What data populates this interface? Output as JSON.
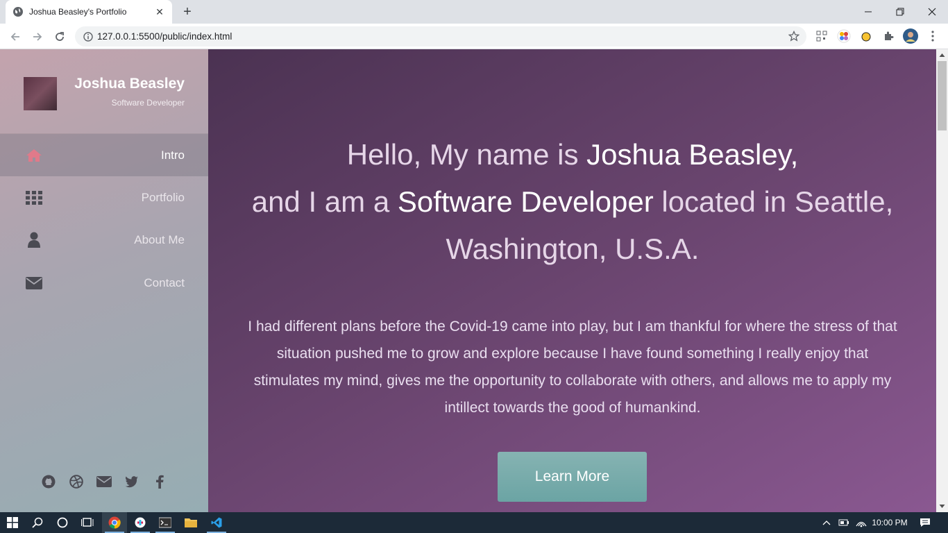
{
  "browser": {
    "tab_title": "Joshua Beasley's Portfolio",
    "url": "127.0.0.1:5500/public/index.html"
  },
  "sidebar": {
    "name": "Joshua Beasley",
    "role": "Software Developer",
    "items": [
      {
        "label": "Intro",
        "icon": "home-icon"
      },
      {
        "label": "Portfolio",
        "icon": "grid-icon"
      },
      {
        "label": "About Me",
        "icon": "user-icon"
      },
      {
        "label": "Contact",
        "icon": "envelope-icon"
      }
    ],
    "socials": [
      "github-icon",
      "dribbble-icon",
      "email-icon",
      "twitter-icon",
      "facebook-icon"
    ]
  },
  "hero": {
    "line1_pre": "Hello, My name is ",
    "line1_name": "Joshua Beasley,",
    "line2_pre": "and I am a ",
    "line2_role": "Software Developer",
    "line2_post": " located in Seattle, Washington, U.S.A.",
    "blurb": "I had different plans before the Covid-19 came into play, but I am thankful for where the stress of that situation pushed me to grow and explore because I have found something I really enjoy that stimulates my mind, gives me the opportunity to collaborate with others, and allows me to apply my intillect towards the good of humankind.",
    "button": "Learn More"
  },
  "taskbar": {
    "time": "10:00 PM"
  },
  "colors": {
    "main_gradient_start": "#4b3252",
    "main_gradient_end": "#8a5891",
    "button": "#77abab",
    "home_icon_active": "#e07a8a"
  }
}
